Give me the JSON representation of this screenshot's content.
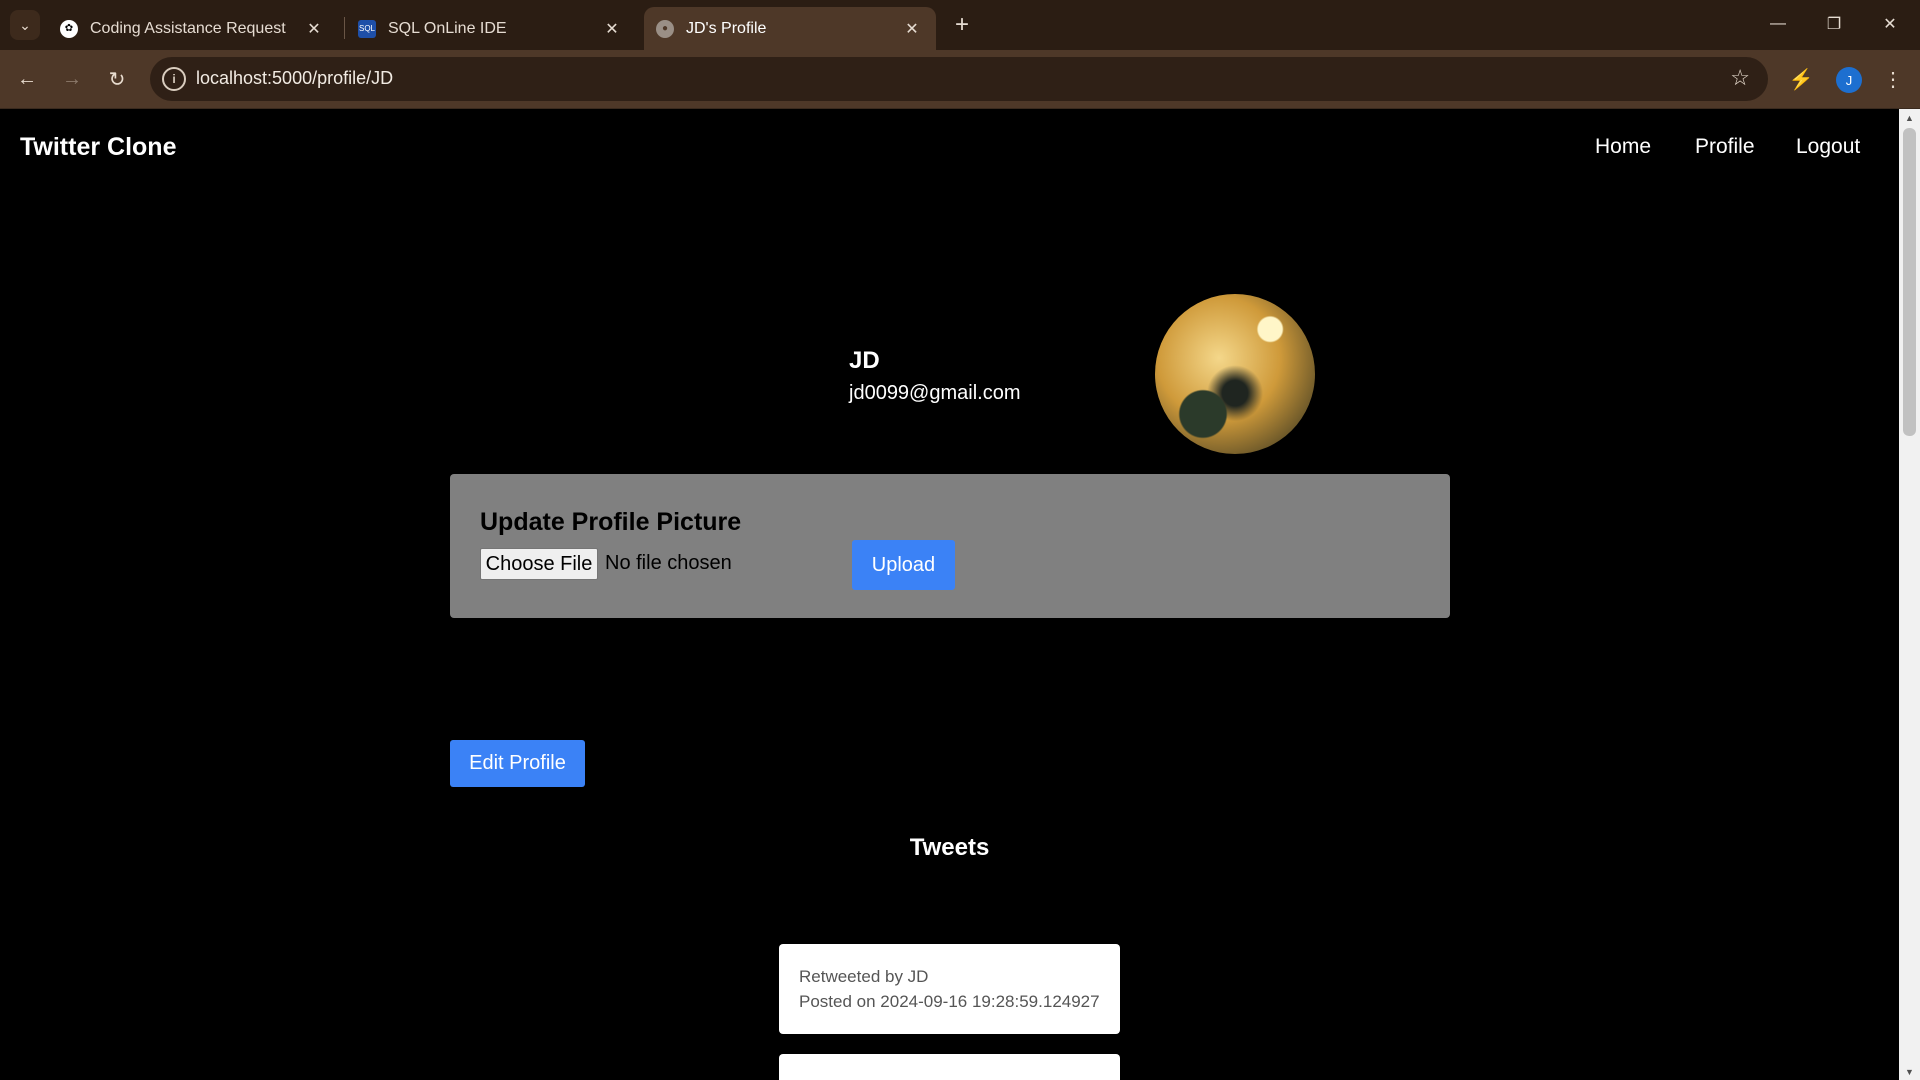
{
  "browser": {
    "tabs": [
      {
        "title": "Coding Assistance Request",
        "favicon": "openai-icon"
      },
      {
        "title": "SQL OnLine IDE",
        "favicon": "sql-icon"
      },
      {
        "title": "JD's Profile",
        "favicon": "globe-icon",
        "active": true
      }
    ],
    "url": "localhost:5000/profile/JD",
    "profile_initial": "J"
  },
  "site": {
    "brand": "Twitter Clone",
    "nav": [
      "Home",
      "Profile",
      "Logout"
    ]
  },
  "profile": {
    "username": "JD",
    "email": "jd0099@gmail.com"
  },
  "upload": {
    "title": "Update Profile Picture",
    "choose_label": "Choose File",
    "file_status": "No file chosen",
    "upload_label": "Upload"
  },
  "edit_label": "Edit Profile",
  "tweets": {
    "heading": "Tweets",
    "items": [
      {
        "retweeted_by": "Retweeted by JD",
        "posted_on": "Posted on 2024-09-16 19:28:59.124927"
      }
    ]
  },
  "colors": {
    "accent": "#3b82f6",
    "panel": "#808080",
    "chrome": "#4e3828"
  }
}
